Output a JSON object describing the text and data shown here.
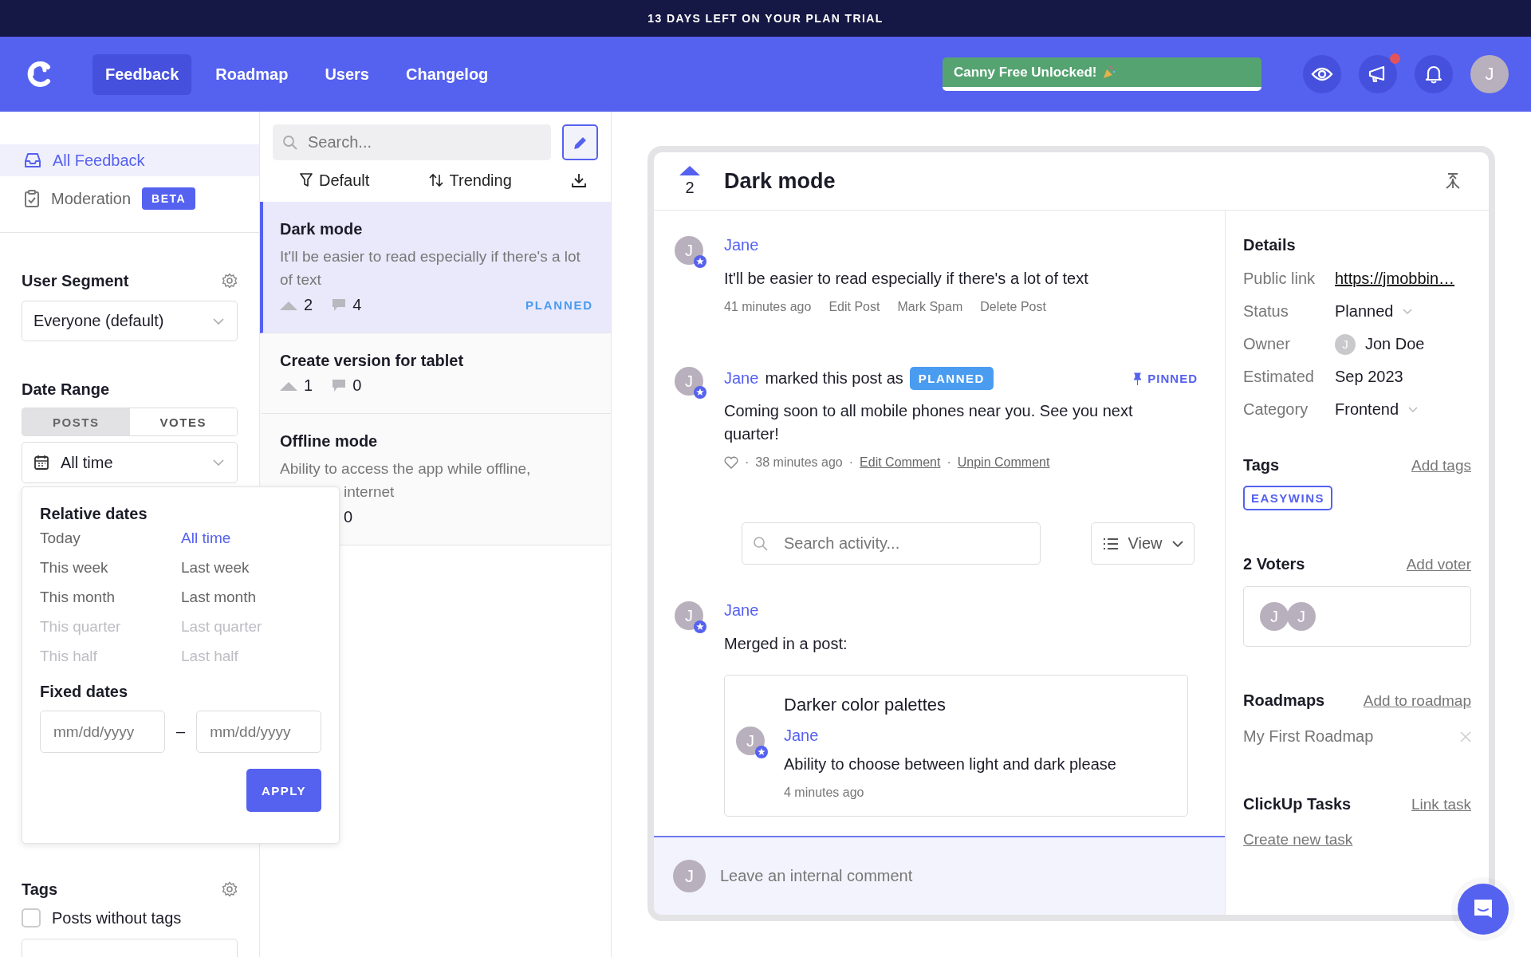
{
  "banner": {
    "text": "13 DAYS LEFT ON YOUR PLAN TRIAL"
  },
  "nav": {
    "tabs": [
      {
        "label": "Feedback",
        "selected": true
      },
      {
        "label": "Roadmap",
        "selected": false
      },
      {
        "label": "Users",
        "selected": false
      },
      {
        "label": "Changelog",
        "selected": false
      }
    ],
    "promo": {
      "label": "Canny Free Unlocked!"
    },
    "announcement_unread": true,
    "avatar": "J"
  },
  "sidebar": {
    "items": [
      {
        "label": "All Feedback",
        "selected": true
      },
      {
        "label": "Moderation",
        "selected": false,
        "badge": "BETA"
      }
    ],
    "user_segment": {
      "title": "User Segment",
      "value": "Everyone (default)"
    },
    "date_range": {
      "title": "Date Range",
      "toggle": [
        {
          "label": "POSTS",
          "selected": true
        },
        {
          "label": "VOTES",
          "selected": false
        }
      ],
      "value": "All time",
      "popover": {
        "relative_title": "Relative dates",
        "options": [
          {
            "label": "Today",
            "selected": false,
            "disabled": false
          },
          {
            "label": "All time",
            "selected": true,
            "disabled": false
          },
          {
            "label": "This week",
            "selected": false,
            "disabled": false
          },
          {
            "label": "Last week",
            "selected": false,
            "disabled": false
          },
          {
            "label": "This month",
            "selected": false,
            "disabled": false
          },
          {
            "label": "Last month",
            "selected": false,
            "disabled": false
          },
          {
            "label": "This quarter",
            "selected": false,
            "disabled": true
          },
          {
            "label": "Last quarter",
            "selected": false,
            "disabled": true
          },
          {
            "label": "This half",
            "selected": false,
            "disabled": true
          },
          {
            "label": "Last half",
            "selected": false,
            "disabled": true
          }
        ],
        "fixed_title": "Fixed dates",
        "start_placeholder": "mm/dd/yyyy",
        "separator": "–",
        "end_placeholder": "mm/dd/yyyy",
        "apply": "APPLY"
      }
    },
    "tags": {
      "title": "Tags",
      "options": [
        {
          "label": "Posts without tags",
          "checked": false
        }
      ]
    }
  },
  "posts": {
    "search_placeholder": "Search...",
    "filter": "Default",
    "sort": "Trending",
    "items": [
      {
        "kind": "full",
        "title": "Dark mode",
        "description": "It'll be easier to read especially if there's a lot of text",
        "votes": "2",
        "comments": "4",
        "status": "PLANNED",
        "selected": true
      },
      {
        "kind": "full",
        "title": "Create version for tablet",
        "votes": "1",
        "comments": "0",
        "selected": false
      },
      {
        "kind": "partly_covered",
        "title": "Offline mode",
        "description_lines": [
          "Ability to access the app while offline,",
          "internet"
        ],
        "comments": "0",
        "selected": false
      }
    ]
  },
  "detail": {
    "votes": "2",
    "title": "Dark mode",
    "activity": [
      {
        "kind": "post",
        "avatar": "J",
        "author": "Jane",
        "text": "It'll be easier to read especially if there's a lot of text",
        "time": "41 minutes ago",
        "actions": [
          "Edit Post",
          "Mark Spam",
          "Delete Post"
        ]
      },
      {
        "kind": "status_change",
        "avatar": "J",
        "author": "Jane",
        "action_text": "marked this post as",
        "status": "PLANNED",
        "pinned": "PINNED",
        "text": "Coming soon to all mobile phones near you. See you next quarter!",
        "liked": false,
        "separator": "·",
        "time": "38 minutes ago",
        "links": [
          "Edit Comment",
          "Unpin Comment"
        ]
      }
    ],
    "search_placeholder": "Search activity...",
    "view": "View",
    "activity_after": [
      {
        "kind": "merge",
        "avatar": "J",
        "author": "Jane",
        "text": "Merged in a post:",
        "merged": {
          "title": "Darker color palettes",
          "avatar": "J",
          "author": "Jane",
          "text": "Ability to choose between light and dark please",
          "time": "4 minutes ago"
        }
      }
    ],
    "composer_avatar": "J",
    "composer_placeholder": "Leave an internal comment"
  },
  "details": {
    "title": "Details",
    "fields": [
      {
        "label": "Public link",
        "value": "https://jmobbin…",
        "kind": "link"
      },
      {
        "label": "Status",
        "value": "Planned",
        "kind": "select"
      },
      {
        "label": "Owner",
        "value": "Jon Doe",
        "kind": "user",
        "avatar": "J"
      },
      {
        "label": "Estimated",
        "value": "Sep 2023",
        "kind": "text"
      },
      {
        "label": "Category",
        "value": "Frontend",
        "kind": "select"
      }
    ],
    "tags": {
      "title": "Tags",
      "action": "Add tags",
      "items": [
        "EASYWINS"
      ]
    },
    "voters": {
      "title": "2 Voters",
      "action": "Add voter",
      "avatars": [
        "J",
        "J"
      ]
    },
    "roadmaps": {
      "title": "Roadmaps",
      "action": "Add to roadmap",
      "items": [
        "My First Roadmap"
      ]
    },
    "clickup": {
      "title": "ClickUp Tasks",
      "action": "Link task",
      "link": "Create new task"
    }
  }
}
